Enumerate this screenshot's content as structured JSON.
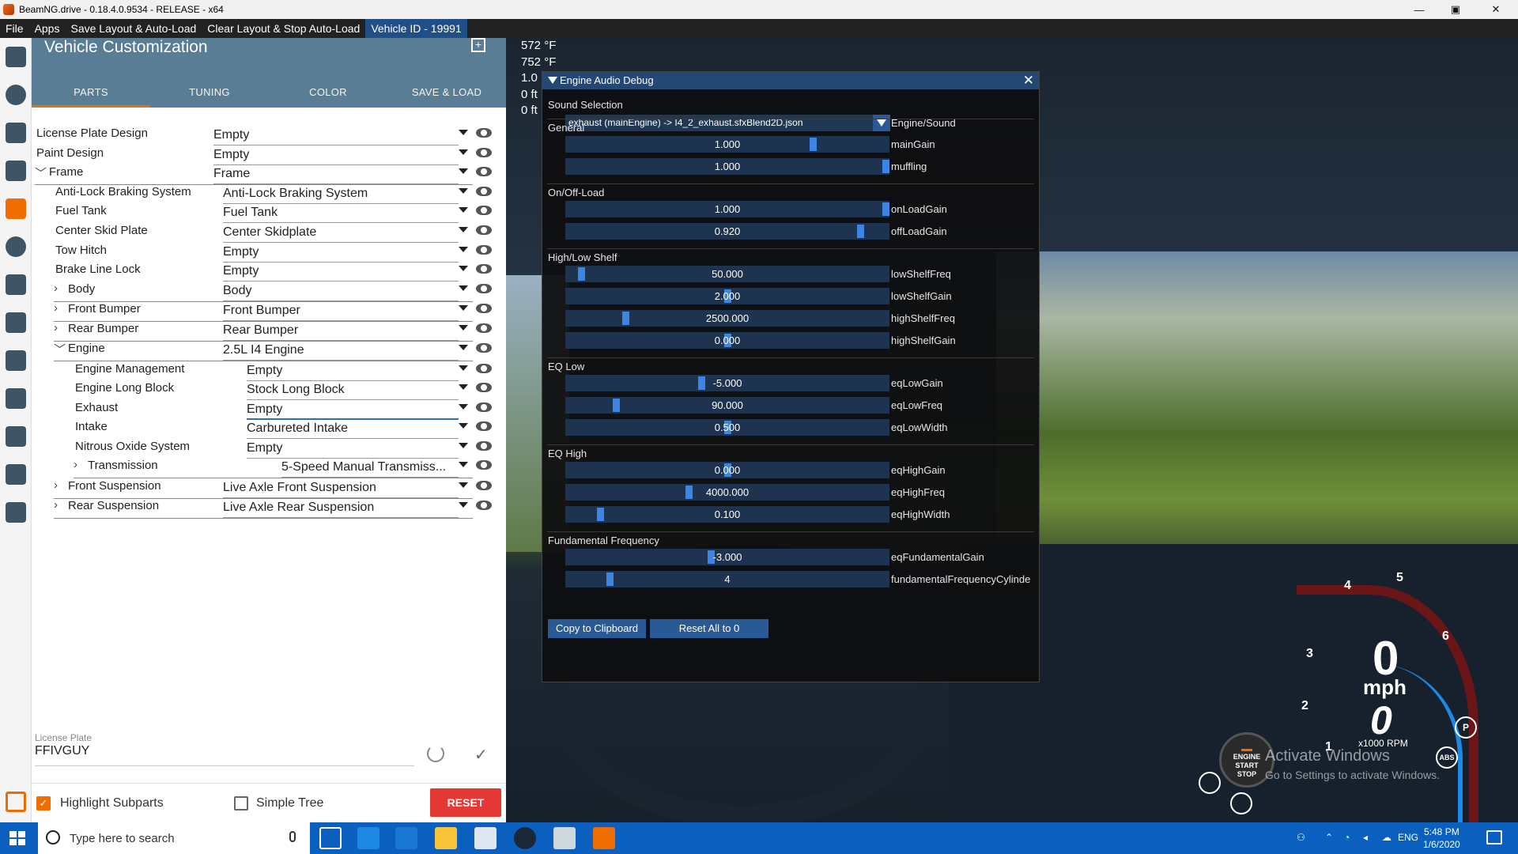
{
  "window": {
    "title": "BeamNG.drive - 0.18.4.0.9534 - RELEASE - x64",
    "minimize": "—",
    "maximize": "▣",
    "close": "✕"
  },
  "menu": [
    "File",
    "Apps",
    "Save Layout & Auto-Load",
    "Clear Layout & Stop Auto-Load",
    "Vehicle ID - 19991"
  ],
  "vehicle_customization": {
    "title": "Vehicle Customization",
    "add_icon": "+",
    "tabs": [
      "PARTS",
      "TUNING",
      "COLOR",
      "SAVE & LOAD"
    ],
    "active_tab": "PARTS",
    "parts": [
      {
        "label": "License Plate Design",
        "value": "Empty",
        "indent": 0,
        "expander": ""
      },
      {
        "label": "Paint Design",
        "value": "Empty",
        "indent": 0,
        "expander": ""
      },
      {
        "label": "Frame",
        "value": "Frame",
        "indent": 0,
        "expander": "﹀"
      },
      {
        "label": "Anti-Lock Braking System",
        "value": "Anti-Lock Braking System",
        "indent": 1,
        "expander": ""
      },
      {
        "label": "Fuel Tank",
        "value": "Fuel Tank",
        "indent": 1,
        "expander": ""
      },
      {
        "label": "Center Skid Plate",
        "value": "Center Skidplate",
        "indent": 1,
        "expander": ""
      },
      {
        "label": "Tow Hitch",
        "value": "Empty",
        "indent": 1,
        "expander": ""
      },
      {
        "label": "Brake Line Lock",
        "value": "Empty",
        "indent": 1,
        "expander": ""
      },
      {
        "label": "Body",
        "value": "Body",
        "indent": 1,
        "expander": "›"
      },
      {
        "label": "Front Bumper",
        "value": "Front Bumper",
        "indent": 1,
        "expander": "›"
      },
      {
        "label": "Rear Bumper",
        "value": "Rear Bumper",
        "indent": 1,
        "expander": "›"
      },
      {
        "label": "Engine",
        "value": "2.5L I4 Engine",
        "indent": 1,
        "expander": "﹀"
      },
      {
        "label": "Engine Management",
        "value": "Empty",
        "indent": 2,
        "expander": ""
      },
      {
        "label": "Engine Long Block",
        "value": "Stock Long Block",
        "indent": 2,
        "expander": ""
      },
      {
        "label": "Exhaust",
        "value": "Empty",
        "indent": 2,
        "expander": ""
      },
      {
        "label": "Intake",
        "value": "Carbureted Intake",
        "indent": 2,
        "expander": ""
      },
      {
        "label": "Nitrous Oxide System",
        "value": "Empty",
        "indent": 2,
        "expander": ""
      },
      {
        "label": "Transmission",
        "value": "5-Speed Manual Transmiss...",
        "indent": 2,
        "expander": "›"
      },
      {
        "label": "Front Suspension",
        "value": "Live Axle Front Suspension",
        "indent": 1,
        "expander": "›"
      },
      {
        "label": "Rear Suspension",
        "value": "Live Axle Rear Suspension",
        "indent": 1,
        "expander": "›"
      }
    ],
    "license_plate_label": "License Plate",
    "license_plate_value": "FFIVGUY",
    "highlight_subparts_label": "Highlight Subparts",
    "highlight_subparts_checked": true,
    "simple_tree_label": "Simple Tree",
    "simple_tree_checked": false,
    "reset_label": "RESET"
  },
  "telemetry": [
    "572 °F",
    "752 °F",
    "1.0",
    "0 ft",
    "0 ft"
  ],
  "engine_audio_debug": {
    "title": "Engine Audio Debug",
    "close_glyph": "✕",
    "sound_selection_label": "Sound Selection",
    "sound_selection_value": "exhaust (mainEngine) -> I4_2_exhaust.sfxBlend2D.json",
    "sound_selection_name": "Engine/Sound",
    "sections": [
      {
        "title": "General",
        "rows": [
          {
            "value": "1.000",
            "name": "mainGain",
            "pos": 0.77
          },
          {
            "value": "1.000",
            "name": "muffling",
            "pos": 1.0
          }
        ]
      },
      {
        "title": "On/Off-Load",
        "rows": [
          {
            "value": "1.000",
            "name": "onLoadGain",
            "pos": 1.0
          },
          {
            "value": "0.920",
            "name": "offLoadGain",
            "pos": 0.92
          }
        ]
      },
      {
        "title": "High/Low Shelf",
        "rows": [
          {
            "value": "50.000",
            "name": "lowShelfFreq",
            "pos": 0.04
          },
          {
            "value": "2.000",
            "name": "lowShelfGain",
            "pos": 0.5
          },
          {
            "value": "2500.000",
            "name": "highShelfFreq",
            "pos": 0.18
          },
          {
            "value": "0.000",
            "name": "highShelfGain",
            "pos": 0.5
          }
        ]
      },
      {
        "title": "EQ Low",
        "rows": [
          {
            "value": "-5.000",
            "name": "eqLowGain",
            "pos": 0.42
          },
          {
            "value": "90.000",
            "name": "eqLowFreq",
            "pos": 0.15
          },
          {
            "value": "0.500",
            "name": "eqLowWidth",
            "pos": 0.5
          }
        ]
      },
      {
        "title": "EQ High",
        "rows": [
          {
            "value": "0.000",
            "name": "eqHighGain",
            "pos": 0.5
          },
          {
            "value": "4000.000",
            "name": "eqHighFreq",
            "pos": 0.38
          },
          {
            "value": "0.100",
            "name": "eqHighWidth",
            "pos": 0.1
          }
        ]
      },
      {
        "title": "Fundamental Frequency",
        "rows": [
          {
            "value": "-3.000",
            "name": "eqFundamentalGain",
            "pos": 0.45
          },
          {
            "value": "4",
            "name": "fundamentalFrequencyCylinde",
            "pos": 0.13
          }
        ]
      }
    ],
    "copy_button": "Copy to Clipboard",
    "reset_button": "Reset All to 0"
  },
  "hud": {
    "speed": "0",
    "speed_unit": "mph",
    "rpm": "0",
    "rpm_label": "x1000 RPM",
    "gear_marks": [
      "1",
      "2",
      "3",
      "4",
      "5",
      "6"
    ],
    "engine_button": [
      "ENGINE",
      "START",
      "STOP"
    ],
    "abs_label": "ABS",
    "parking_label": "P"
  },
  "watermark": {
    "line1": "Activate Windows",
    "line2": "Go to Settings to activate Windows."
  },
  "taskbar": {
    "search_placeholder": "Type here to search",
    "language": "ENG",
    "time": "5:48 PM",
    "date": "1/6/2020"
  }
}
